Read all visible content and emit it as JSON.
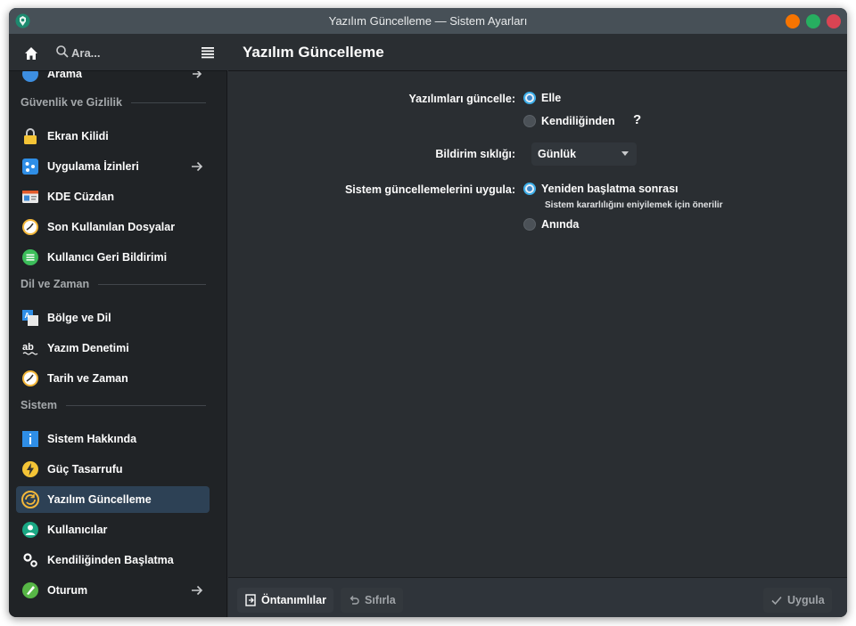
{
  "window": {
    "title": "Yazılım Güncelleme — Sistem Ayarları",
    "controls": [
      "minimize-icon",
      "maximize-icon",
      "close-icon"
    ],
    "control_colors": {
      "minimize": "#f67400",
      "maximize": "#27ae60",
      "close": "#da4453"
    }
  },
  "sidebar": {
    "search_placeholder": "Ara...",
    "partial_item": {
      "label": "Arama"
    },
    "sections": [
      {
        "title": "Güvenlik ve Gizlilik",
        "items": [
          {
            "label": "Ekran Kilidi",
            "icon": "lock-icon"
          },
          {
            "label": "Uygulama İzinleri",
            "icon": "permissions-icon",
            "arrow": true
          },
          {
            "label": "KDE Cüzdan",
            "icon": "wallet-icon"
          },
          {
            "label": "Son Kullanılan Dosyalar",
            "icon": "recent-files-icon"
          },
          {
            "label": "Kullanıcı Geri Bildirimi",
            "icon": "feedback-icon"
          }
        ]
      },
      {
        "title": "Dil ve Zaman",
        "items": [
          {
            "label": "Bölge ve Dil",
            "icon": "region-language-icon"
          },
          {
            "label": "Yazım Denetimi",
            "icon": "spellcheck-icon"
          },
          {
            "label": "Tarih ve Zaman",
            "icon": "clock-icon"
          }
        ]
      },
      {
        "title": "Sistem",
        "items": [
          {
            "label": "Sistem Hakkında",
            "icon": "info-icon"
          },
          {
            "label": "Güç Tasarrufu",
            "icon": "power-icon"
          },
          {
            "label": "Yazılım Güncelleme",
            "icon": "update-icon",
            "selected": true
          },
          {
            "label": "Kullanıcılar",
            "icon": "users-icon"
          },
          {
            "label": "Kendiliğinden Başlatma",
            "icon": "autostart-icon"
          },
          {
            "label": "Oturum",
            "icon": "session-icon",
            "arrow": true
          }
        ]
      }
    ]
  },
  "main": {
    "title": "Yazılım Güncelleme",
    "update_label": "Yazılımları güncelle:",
    "update_options": [
      {
        "label": "Elle",
        "checked": true
      },
      {
        "label": "Kendiliğinden",
        "checked": false
      }
    ],
    "help_label": "?",
    "frequency_label": "Bildirim sıklığı:",
    "frequency_value": "Günlük",
    "apply_label": "Sistem güncellemelerini uygula:",
    "apply_options": [
      {
        "label": "Yeniden başlatma sonrası",
        "checked": true,
        "hint": "Sistem kararlılığını eniyilemek için önerilir"
      },
      {
        "label": "Anında",
        "checked": false
      }
    ]
  },
  "footer": {
    "defaults_label": "Öntanımlılar",
    "reset_label": "Sıfırla",
    "apply_label": "Uygula"
  }
}
